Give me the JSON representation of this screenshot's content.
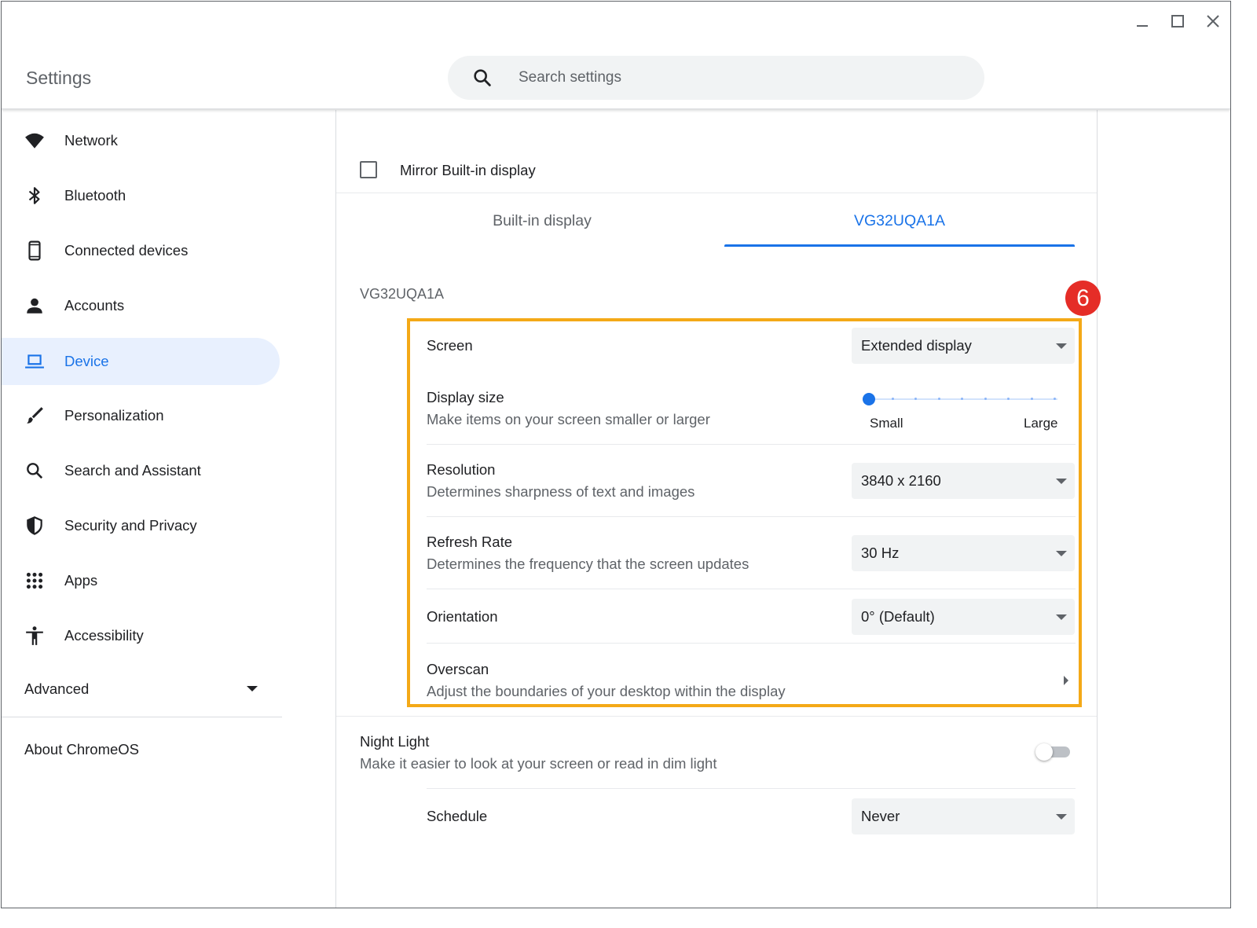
{
  "window": {
    "minimize_label": "Minimize",
    "maximize_label": "Maximize",
    "close_label": "Close"
  },
  "header": {
    "title": "Settings",
    "search_placeholder": "Search settings"
  },
  "sidebar": {
    "items": [
      {
        "label": "Network",
        "icon": "wifi-icon"
      },
      {
        "label": "Bluetooth",
        "icon": "bluetooth-icon"
      },
      {
        "label": "Connected devices",
        "icon": "phone-icon"
      },
      {
        "label": "Accounts",
        "icon": "person-icon"
      },
      {
        "label": "Device",
        "icon": "laptop-icon",
        "active": true
      },
      {
        "label": "Personalization",
        "icon": "brush-icon"
      },
      {
        "label": "Search and Assistant",
        "icon": "search-icon"
      },
      {
        "label": "Security and Privacy",
        "icon": "shield-icon"
      },
      {
        "label": "Apps",
        "icon": "grid-icon"
      },
      {
        "label": "Accessibility",
        "icon": "accessibility-icon"
      }
    ],
    "advanced_label": "Advanced",
    "about_label": "About ChromeOS"
  },
  "display": {
    "mirror_label": "Mirror Built-in display",
    "mirror_checked": false,
    "tabs": [
      {
        "label": "Built-in display",
        "active": false
      },
      {
        "label": "VG32UQA1A",
        "active": true
      }
    ],
    "section_title": "VG32UQA1A",
    "screen": {
      "label": "Screen",
      "value": "Extended display"
    },
    "display_size": {
      "label": "Display size",
      "description": "Make items on your screen smaller or larger",
      "min_label": "Small",
      "max_label": "Large",
      "level": 0
    },
    "resolution": {
      "label": "Resolution",
      "description": "Determines sharpness of text and images",
      "value": "3840 x 2160"
    },
    "refresh_rate": {
      "label": "Refresh Rate",
      "description": "Determines the frequency that the screen updates",
      "value": "30 Hz"
    },
    "orientation": {
      "label": "Orientation",
      "value": "0° (Default)"
    },
    "overscan": {
      "label": "Overscan",
      "description": "Adjust the boundaries of your desktop within the display"
    },
    "night_light": {
      "label": "Night Light",
      "description": "Make it easier to look at your screen or read in dim light",
      "enabled": false
    },
    "schedule": {
      "label": "Schedule",
      "value": "Never"
    }
  },
  "annotation": {
    "badge": "6",
    "color": "#f4a917",
    "badge_color": "#e52d27"
  },
  "colors": {
    "accent": "#1a73e8",
    "active_bg": "#e8f0fe"
  }
}
